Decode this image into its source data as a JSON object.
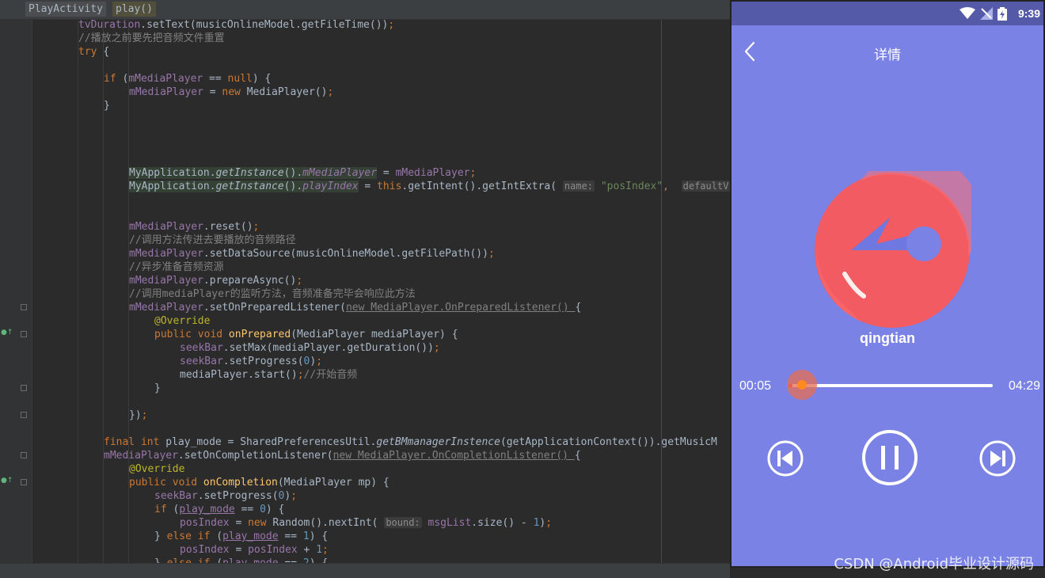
{
  "ide": {
    "breadcrumbs": [
      "PlayActivity",
      "play()"
    ],
    "hints": {
      "name": "name:",
      "default": "defaultV",
      "bound": "bound:"
    }
  },
  "phone": {
    "status": {
      "time": "9:39"
    },
    "header": {
      "title": "详情"
    },
    "player": {
      "song_title": "qingtian",
      "current_time": "00:05",
      "total_time": "04:29",
      "progress": 0.02
    },
    "colors": {
      "background": "#7b82e6",
      "status_bar": "#555aa8",
      "disc": "#f25b62",
      "seek_thumb": "#ff8a1f"
    },
    "controls": [
      "skip-previous-icon",
      "pause-icon",
      "skip-next-icon"
    ]
  },
  "watermark": "CSDN @Android毕业设计源码"
}
